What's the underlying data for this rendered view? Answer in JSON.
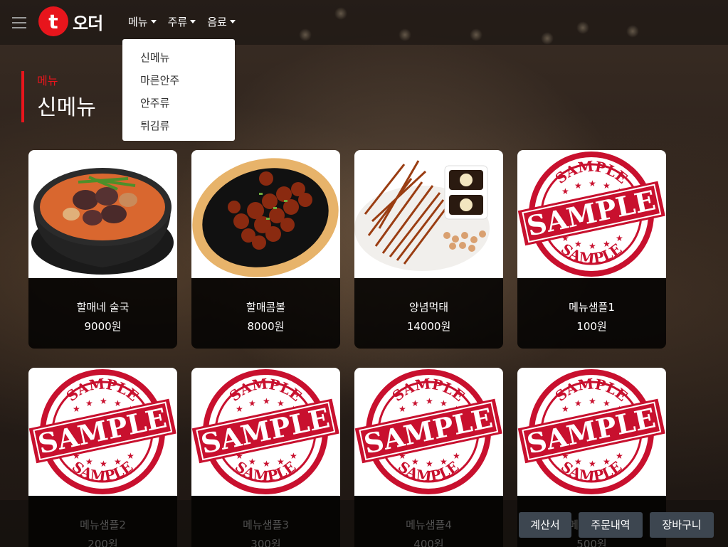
{
  "brand": {
    "logo_letter": "t",
    "logo_text": "오더"
  },
  "nav": {
    "items": [
      {
        "label": "메뉴"
      },
      {
        "label": "주류"
      },
      {
        "label": "음료"
      }
    ]
  },
  "dropdown": {
    "items": [
      "신메뉴",
      "마른안주",
      "안주류",
      "튀김류"
    ]
  },
  "section": {
    "subtitle": "메뉴",
    "title": "신메뉴"
  },
  "cards": [
    {
      "name": "할매네 술국",
      "price": "9000원",
      "image": "stew-photo"
    },
    {
      "name": "할매콤볼",
      "price": "8000원",
      "image": "spicy-balls-photo"
    },
    {
      "name": "양념먹태",
      "price": "14000원",
      "image": "dried-fish-photo"
    },
    {
      "name": "메뉴샘플1",
      "price": "100원",
      "image": "sample-stamp"
    },
    {
      "name": "메뉴샘플2",
      "price": "200원",
      "image": "sample-stamp"
    },
    {
      "name": "메뉴샘플3",
      "price": "300원",
      "image": "sample-stamp"
    },
    {
      "name": "메뉴샘플4",
      "price": "400원",
      "image": "sample-stamp"
    },
    {
      "name": "메뉴샘플5",
      "price": "500원",
      "image": "sample-stamp"
    }
  ],
  "stamp": {
    "big": "SAMPLE",
    "small": "SAMPLE"
  },
  "buttons": {
    "bill": "계산서",
    "orders": "주문내역",
    "cart": "장바구니"
  },
  "colors": {
    "accent": "#e8151c",
    "button_bg": "#3d4650",
    "stamp_red": "#c8102e"
  }
}
